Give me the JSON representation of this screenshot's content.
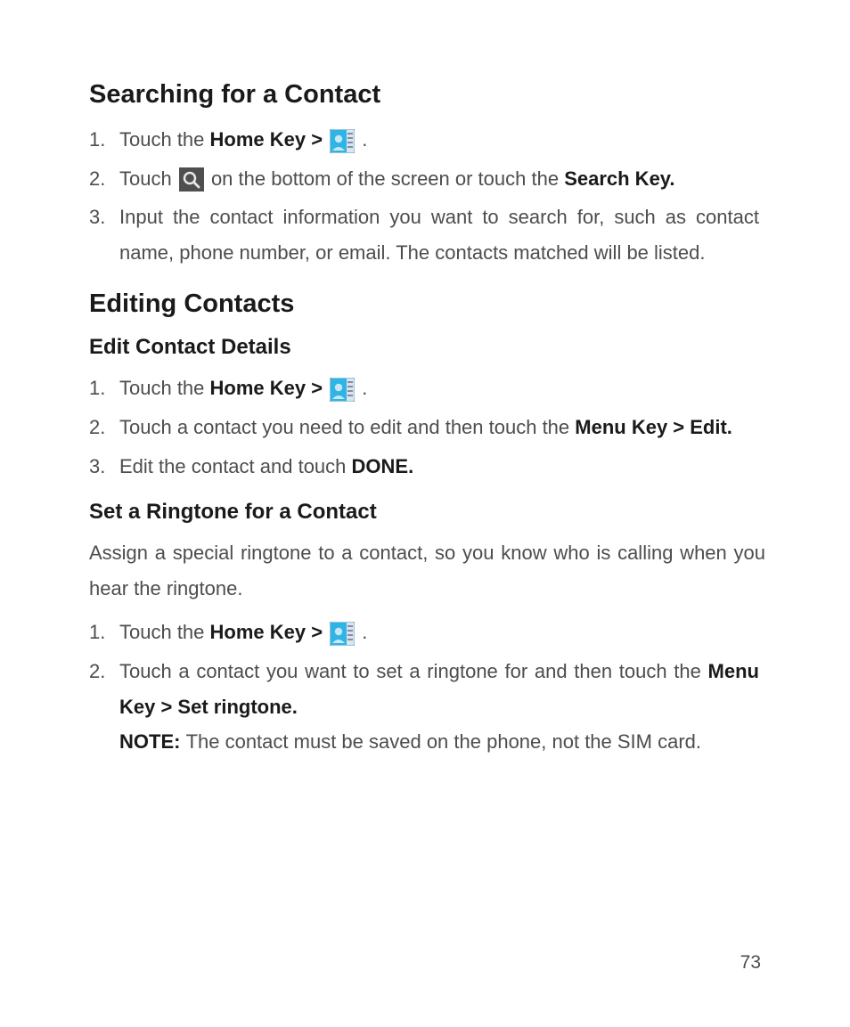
{
  "page_number": "73",
  "section1": {
    "title": "Searching for a Contact",
    "items": [
      {
        "num": "1.",
        "pre": "Touch the ",
        "bold": "Home Key > ",
        "post": " ."
      },
      {
        "num": "2.",
        "pre": "Touch ",
        "mid": " on the bottom of the screen or touch the ",
        "bold": "Search Key."
      },
      {
        "num": "3.",
        "text": "Input the contact information you want to search for, such as contact name, phone number, or email. The contacts matched will be listed."
      }
    ]
  },
  "section2": {
    "title": "Editing Contacts",
    "sub1": {
      "title": "Edit Contact Details",
      "items": [
        {
          "num": "1.",
          "pre": "Touch the ",
          "bold": "Home Key > ",
          "post": " ."
        },
        {
          "num": "2.",
          "pre": "Touch a contact you need to edit and then touch the ",
          "bold": "Menu Key > Edit."
        },
        {
          "num": "3.",
          "pre": "Edit the contact and touch ",
          "bold": "DONE."
        }
      ]
    },
    "sub2": {
      "title": "Set a Ringtone for a Contact",
      "intro": "Assign a special ringtone to a contact, so you know who is calling when you hear the ringtone.",
      "items": [
        {
          "num": "1.",
          "pre": "Touch the ",
          "bold": "Home Key > ",
          "post": " ."
        },
        {
          "num": "2.",
          "pre": "Touch a contact you want to set a ringtone for and then touch the ",
          "bold": "Menu Key > Set ringtone.",
          "note_label": "NOTE: ",
          "note_text": "The contact must be saved on the phone, not the SIM card."
        }
      ]
    }
  }
}
